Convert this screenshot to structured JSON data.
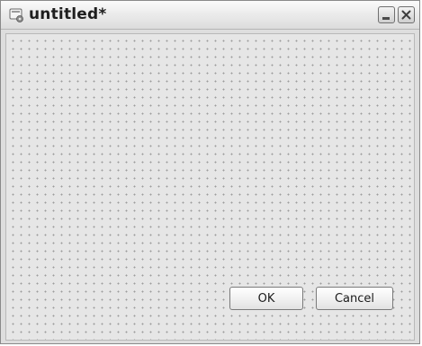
{
  "window": {
    "title": "untitled*"
  },
  "icons": {
    "app": "app-icon",
    "minimize": "minimize-icon",
    "close": "close-icon"
  },
  "buttons": {
    "ok_label": "OK",
    "cancel_label": "Cancel"
  },
  "canvas": {
    "grid": "dotted"
  }
}
